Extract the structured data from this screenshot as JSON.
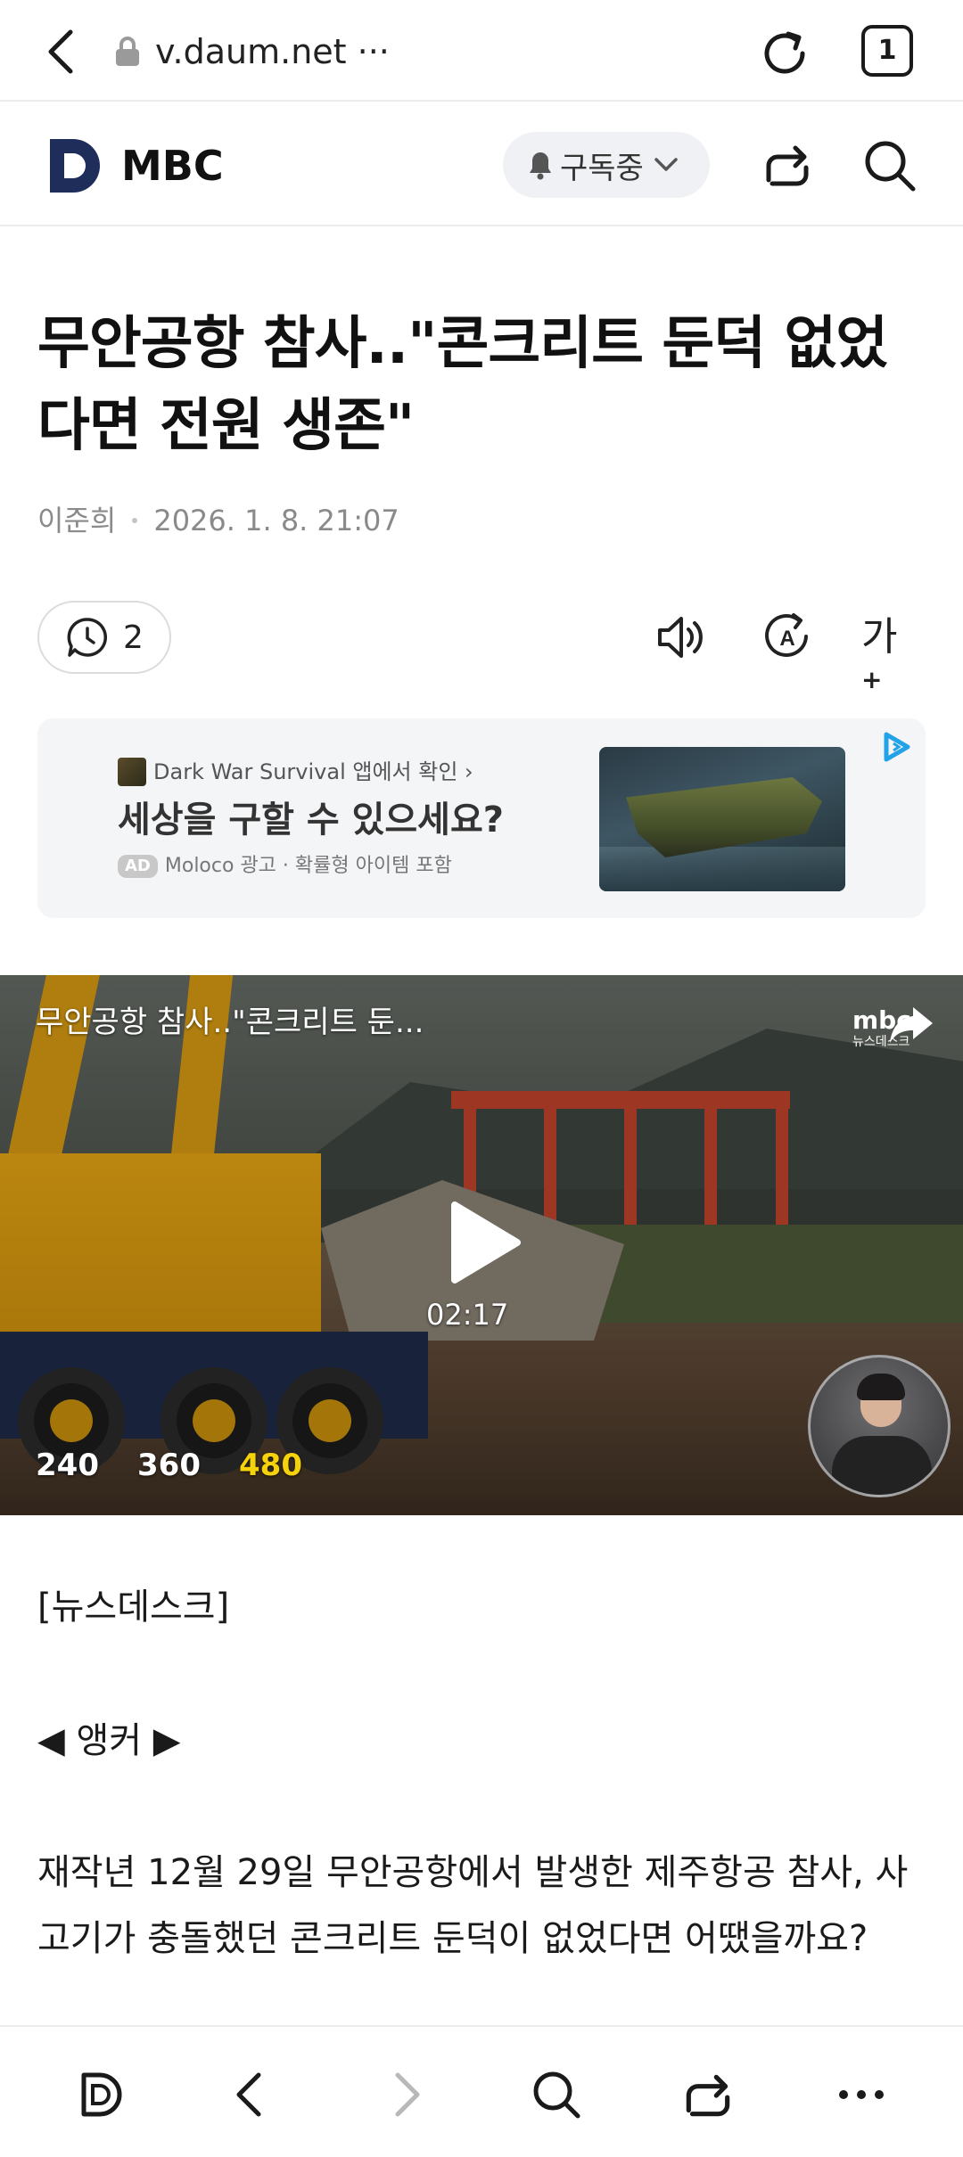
{
  "browser": {
    "url": "v.daum.net ···",
    "tab_count": "1"
  },
  "header": {
    "publisher": "MBC",
    "subscribe_label": "구독중"
  },
  "article": {
    "title": "무안공항 참사..\"콘크리트 둔덕 없었다면 전원 생존\"",
    "author": "이준희",
    "datetime": "2026. 1. 8. 21:07",
    "comment_count": "2",
    "font_button": "가"
  },
  "ad": {
    "source": "Dark War Survival 앱에서 확인 ›",
    "headline": "세상을 구할 수 있으세요?",
    "badge": "AD",
    "sponsor": "Moloco 광고 · 확률형 아이템 포함"
  },
  "video": {
    "title": "무안공항 참사..\"콘크리트 둔...",
    "channel_logo": "mbc",
    "channel_sub": "뉴스데스크",
    "duration": "02:17",
    "qualities": [
      "240",
      "360",
      "480"
    ],
    "selected_quality": "480"
  },
  "body": {
    "p1": "[뉴스데스크]",
    "p2": "◀ 앵커 ▶",
    "p3": "재작년 12월 29일 무안공항에서 발생한 제주항공 참사, 사고기가 충돌했던 콘크리트 둔덕이 없었다면 어땠을까요?"
  },
  "colors": {
    "accent_logo": "#1e2d5a",
    "selected_quality": "#f5d20a",
    "adchoice": "#22a2e8"
  }
}
